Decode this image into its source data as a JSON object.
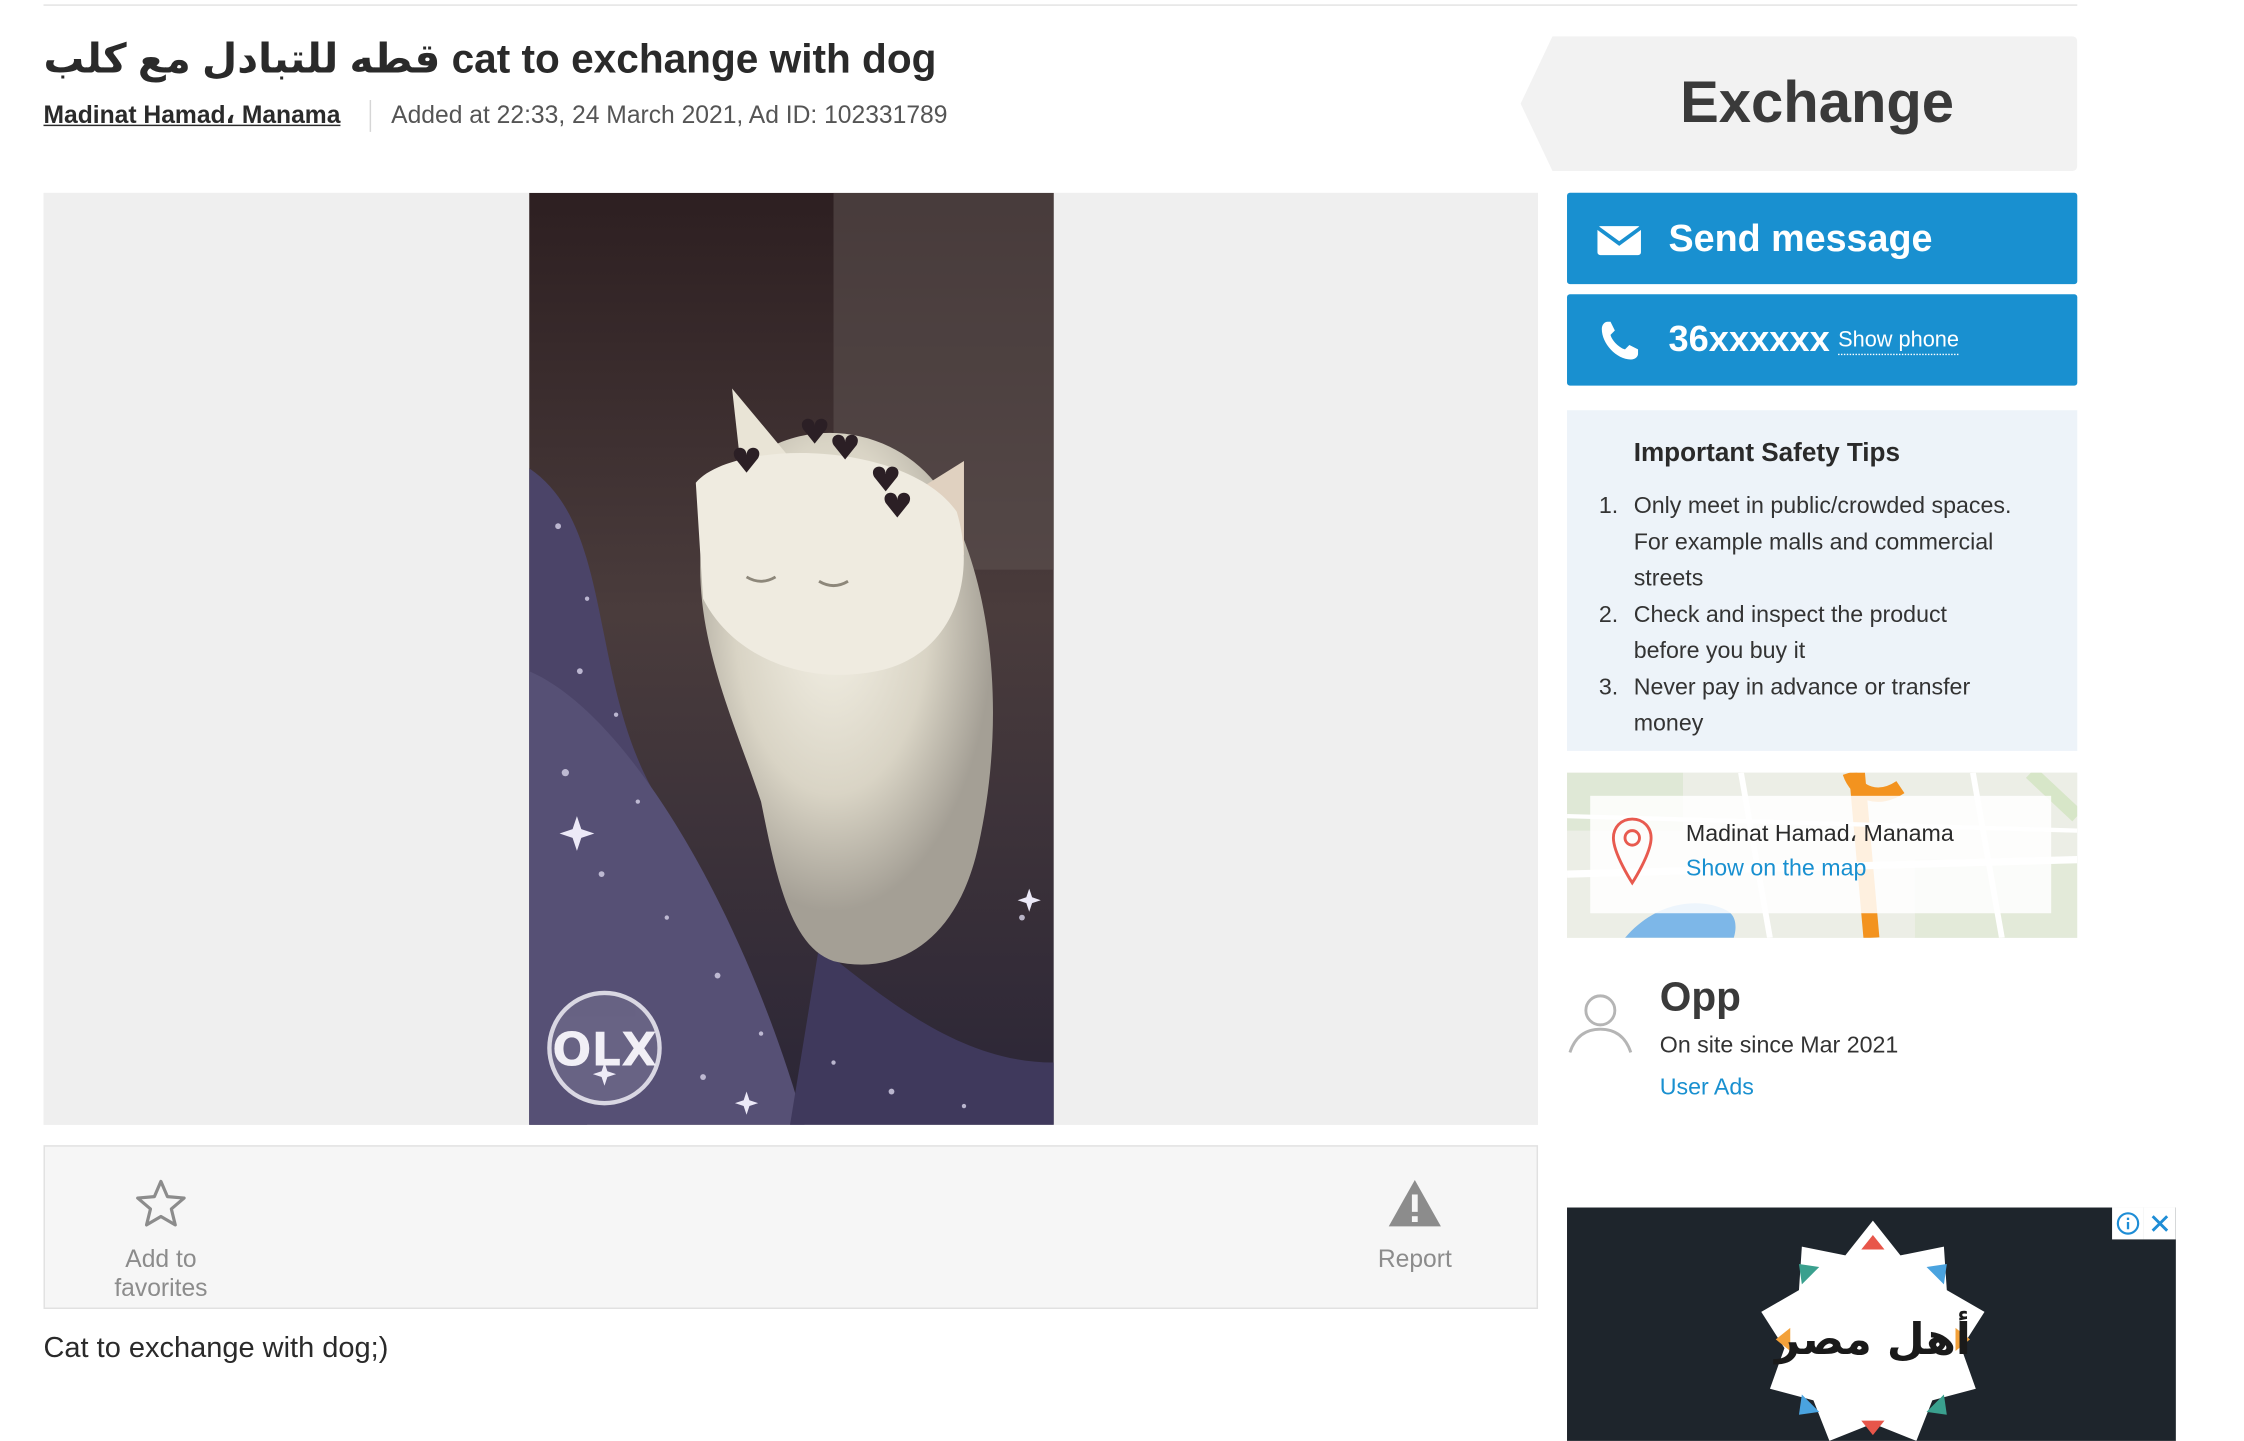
{
  "ad": {
    "title": "قطه للتبادل مع كلب cat to exchange with dog",
    "location": "Madinat Hamad، Manama",
    "added": "Added at 22:33, 24 March 2021, Ad ID: 102331789",
    "description": "Cat to exchange with dog;)",
    "photo_watermark": "OLX"
  },
  "actions": {
    "favorites_label": "Add to favorites",
    "report_label": "Report"
  },
  "sidebar": {
    "price_label": "Exchange",
    "send_message_label": "Send message",
    "phone_masked": "36xxxxxx",
    "show_phone_label": "Show phone",
    "safety": {
      "title": "Important Safety Tips",
      "tips": [
        "Only meet in public/crowded spaces. For example malls and commercial streets",
        "Check and inspect the product before you buy it",
        "Never pay in advance or transfer money"
      ]
    },
    "map": {
      "location": "Madinat Hamad، Manama",
      "link_label": "Show on the map"
    },
    "seller": {
      "name": "Opp",
      "since": "On site since Mar 2021",
      "user_ads_label": "User Ads"
    },
    "ad_banner": {
      "logo_text": "أهل مصر"
    }
  },
  "colors": {
    "primary_blue": "#1990d0",
    "safety_bg": "#edf3f9",
    "gallery_bg": "#efefef",
    "ad_bg": "#1e252c"
  },
  "icons": [
    "envelope-icon",
    "phone-icon",
    "star-icon",
    "warning-icon",
    "map-pin-icon",
    "user-icon",
    "info-icon",
    "close-icon"
  ]
}
